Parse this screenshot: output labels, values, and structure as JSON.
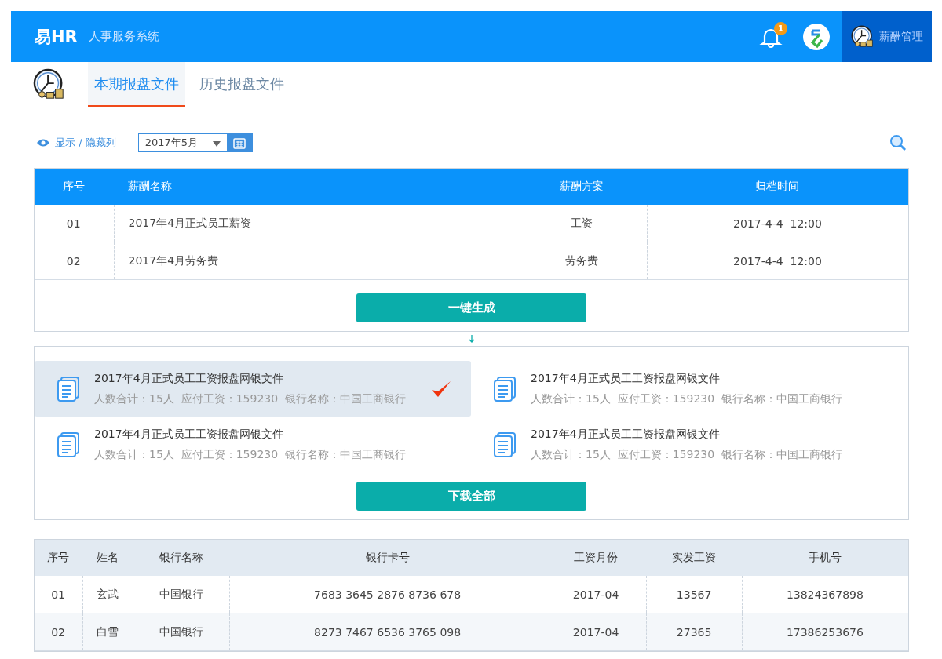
{
  "header": {
    "logo": "易HR",
    "subtitle": "人事服务系统",
    "notification_count": "1",
    "module": "薪酬管理"
  },
  "tabs": [
    {
      "label": "本期报盘文件",
      "selected": true
    },
    {
      "label": "历史报盘文件",
      "selected": false
    }
  ],
  "toolbar": {
    "toggle_columns": "显示 / 隐藏列",
    "month": "2017年5月"
  },
  "salary_table": {
    "columns": [
      "序号",
      "薪酬名称",
      "薪酬方案",
      "归档时间"
    ],
    "rows": [
      [
        "01",
        "2017年4月正式员工薪资",
        "工资",
        "2017-4-4  12:00"
      ],
      [
        "02",
        "2017年4月劳务费",
        "劳务费",
        "2017-4-4  12:00"
      ]
    ],
    "action": "一键生成"
  },
  "files": [
    {
      "title": "2017年4月正式员工工资报盘网银文件",
      "detail": "人数合计：15人  应付工资：159230  银行名称：中国工商银行",
      "selected": true
    },
    {
      "title": "2017年4月正式员工工资报盘网银文件",
      "detail": "人数合计：15人  应付工资：159230  银行名称：中国工商银行",
      "selected": false
    },
    {
      "title": "2017年4月正式员工工资报盘网银文件",
      "detail": "人数合计：15人  应付工资：159230  银行名称：中国工商银行",
      "selected": false
    },
    {
      "title": "2017年4月正式员工工资报盘网银文件",
      "detail": "人数合计：15人  应付工资：159230  银行名称：中国工商银行",
      "selected": false
    }
  ],
  "download_all": "下载全部",
  "detail_table": {
    "columns": [
      "序号",
      "姓名",
      "银行名称",
      "银行卡号",
      "工资月份",
      "实发工资",
      "手机号"
    ],
    "rows": [
      [
        "01",
        "玄武",
        "中国银行",
        "7683 3645 2876 8736 678",
        "2017-04",
        "13567",
        "13824367898"
      ],
      [
        "02",
        "白雪",
        "中国银行",
        "8273 7467 6536 3765 098",
        "2017-04",
        "27365",
        "17386253676"
      ]
    ]
  }
}
